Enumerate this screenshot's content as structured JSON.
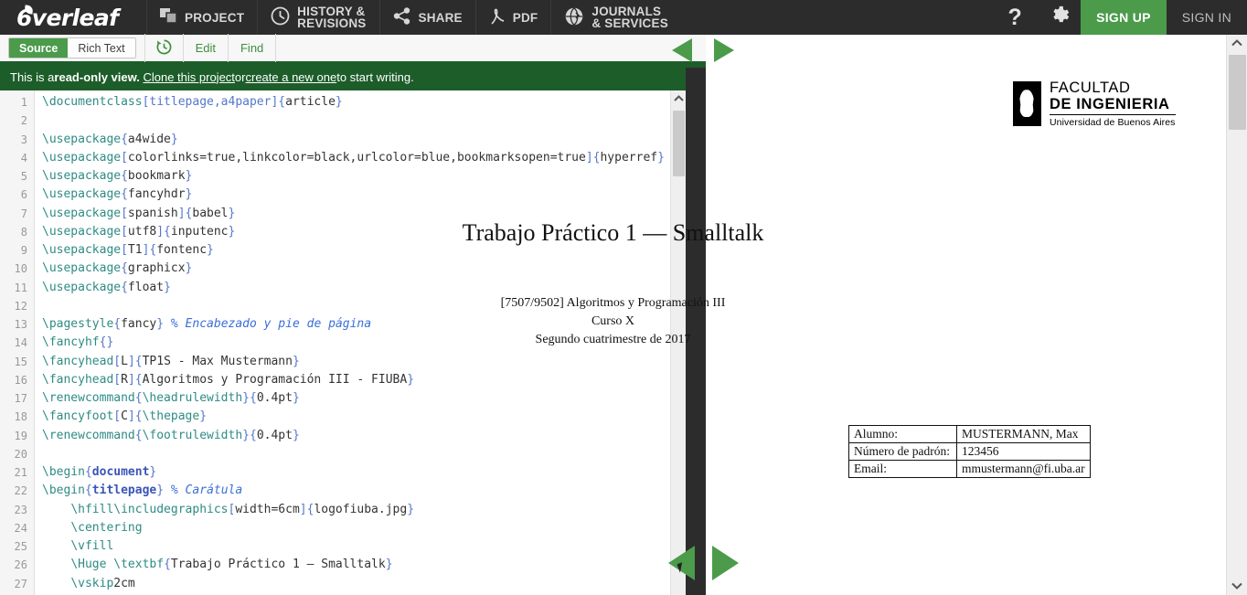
{
  "topnav": {
    "brand": "verleaf",
    "items": [
      {
        "name": "project",
        "label": "PROJECT",
        "icon": "windows-icon"
      },
      {
        "name": "history",
        "label": "HISTORY &",
        "label2": "REVISIONS",
        "icon": "clock-icon"
      },
      {
        "name": "share",
        "label": "SHARE",
        "icon": "share-icon"
      },
      {
        "name": "pdf",
        "label": "PDF",
        "icon": "pdf-icon"
      },
      {
        "name": "journals",
        "label": "JOURNALS",
        "label2": "& SERVICES",
        "icon": "globe-icon"
      }
    ],
    "help_icon": "question-mark-icon",
    "settings_icon": "gear-icon",
    "signup": "SIGN UP",
    "signin": "SIGN IN",
    "accent_green": "#4b9b4b",
    "bar_bg": "#2c2c2c"
  },
  "toolbar": {
    "source": "Source",
    "rich_text": "Rich Text",
    "history_icon": "history-clock-icon",
    "edit": "Edit",
    "find": "Find"
  },
  "banner": {
    "prefix": "This is a ",
    "bold": "read-only view.",
    "link1": "Clone this project",
    "mid": " or ",
    "link2": "create a new one",
    "suffix": " to start writing.",
    "bg": "#1d5d2a"
  },
  "editor": {
    "first_line": 1,
    "lines": [
      {
        "n": 1,
        "tokens": [
          {
            "t": "cmd",
            "v": "\\documentclass"
          },
          {
            "t": "br",
            "v": "[titlepage,a4paper]"
          },
          {
            "t": "br",
            "v": "{"
          },
          {
            "t": "txt",
            "v": "article"
          },
          {
            "t": "br",
            "v": "}"
          }
        ]
      },
      {
        "n": 2,
        "tokens": []
      },
      {
        "n": 3,
        "tokens": [
          {
            "t": "cmd",
            "v": "\\usepackage"
          },
          {
            "t": "br",
            "v": "{"
          },
          {
            "t": "txt",
            "v": "a4wide"
          },
          {
            "t": "br",
            "v": "}"
          }
        ]
      },
      {
        "n": 4,
        "tokens": [
          {
            "t": "cmd",
            "v": "\\usepackage"
          },
          {
            "t": "br",
            "v": "["
          },
          {
            "t": "txt",
            "v": "colorlinks=true,linkcolor=black,urlcolor=blue,bookmarksopen=true"
          },
          {
            "t": "br",
            "v": "]{"
          },
          {
            "t": "txt",
            "v": "hyperref"
          },
          {
            "t": "br",
            "v": "}"
          }
        ]
      },
      {
        "n": 5,
        "tokens": [
          {
            "t": "cmd",
            "v": "\\usepackage"
          },
          {
            "t": "br",
            "v": "{"
          },
          {
            "t": "txt",
            "v": "bookmark"
          },
          {
            "t": "br",
            "v": "}"
          }
        ]
      },
      {
        "n": 6,
        "tokens": [
          {
            "t": "cmd",
            "v": "\\usepackage"
          },
          {
            "t": "br",
            "v": "{"
          },
          {
            "t": "txt",
            "v": "fancyhdr"
          },
          {
            "t": "br",
            "v": "}"
          }
        ]
      },
      {
        "n": 7,
        "tokens": [
          {
            "t": "cmd",
            "v": "\\usepackage"
          },
          {
            "t": "br",
            "v": "["
          },
          {
            "t": "txt",
            "v": "spanish"
          },
          {
            "t": "br",
            "v": "]{"
          },
          {
            "t": "txt",
            "v": "babel"
          },
          {
            "t": "br",
            "v": "}"
          }
        ]
      },
      {
        "n": 8,
        "tokens": [
          {
            "t": "cmd",
            "v": "\\usepackage"
          },
          {
            "t": "br",
            "v": "["
          },
          {
            "t": "txt",
            "v": "utf8"
          },
          {
            "t": "br",
            "v": "]{"
          },
          {
            "t": "txt",
            "v": "inputenc"
          },
          {
            "t": "br",
            "v": "}"
          }
        ]
      },
      {
        "n": 9,
        "tokens": [
          {
            "t": "cmd",
            "v": "\\usepackage"
          },
          {
            "t": "br",
            "v": "["
          },
          {
            "t": "txt",
            "v": "T1"
          },
          {
            "t": "br",
            "v": "]{"
          },
          {
            "t": "txt",
            "v": "fontenc"
          },
          {
            "t": "br",
            "v": "}"
          }
        ]
      },
      {
        "n": 10,
        "tokens": [
          {
            "t": "cmd",
            "v": "\\usepackage"
          },
          {
            "t": "br",
            "v": "{"
          },
          {
            "t": "txt",
            "v": "graphicx"
          },
          {
            "t": "br",
            "v": "}"
          }
        ]
      },
      {
        "n": 11,
        "tokens": [
          {
            "t": "cmd",
            "v": "\\usepackage"
          },
          {
            "t": "br",
            "v": "{"
          },
          {
            "t": "txt",
            "v": "float"
          },
          {
            "t": "br",
            "v": "}"
          }
        ]
      },
      {
        "n": 12,
        "tokens": []
      },
      {
        "n": 13,
        "tokens": [
          {
            "t": "cmd",
            "v": "\\pagestyle"
          },
          {
            "t": "br",
            "v": "{"
          },
          {
            "t": "txt",
            "v": "fancy"
          },
          {
            "t": "br",
            "v": "}"
          },
          {
            "t": "txt",
            "v": " "
          },
          {
            "t": "com",
            "v": "% Encabezado y pie de página"
          }
        ]
      },
      {
        "n": 14,
        "tokens": [
          {
            "t": "cmd",
            "v": "\\fancyhf"
          },
          {
            "t": "br",
            "v": "{}"
          }
        ]
      },
      {
        "n": 15,
        "tokens": [
          {
            "t": "cmd",
            "v": "\\fancyhead"
          },
          {
            "t": "br",
            "v": "["
          },
          {
            "t": "txt",
            "v": "L"
          },
          {
            "t": "br",
            "v": "]{"
          },
          {
            "t": "txt",
            "v": "TP1S - Max Mustermann"
          },
          {
            "t": "br",
            "v": "}"
          }
        ]
      },
      {
        "n": 16,
        "tokens": [
          {
            "t": "cmd",
            "v": "\\fancyhead"
          },
          {
            "t": "br",
            "v": "["
          },
          {
            "t": "txt",
            "v": "R"
          },
          {
            "t": "br",
            "v": "]{"
          },
          {
            "t": "txt",
            "v": "Algoritmos y Programación III - FIUBA"
          },
          {
            "t": "br",
            "v": "}"
          }
        ]
      },
      {
        "n": 17,
        "tokens": [
          {
            "t": "cmd",
            "v": "\\renewcommand"
          },
          {
            "t": "br",
            "v": "{"
          },
          {
            "t": "cmd",
            "v": "\\headrulewidth"
          },
          {
            "t": "br",
            "v": "}{"
          },
          {
            "t": "txt",
            "v": "0.4pt"
          },
          {
            "t": "br",
            "v": "}"
          }
        ]
      },
      {
        "n": 18,
        "tokens": [
          {
            "t": "cmd",
            "v": "\\fancyfoot"
          },
          {
            "t": "br",
            "v": "["
          },
          {
            "t": "txt",
            "v": "C"
          },
          {
            "t": "br",
            "v": "]{"
          },
          {
            "t": "cmd",
            "v": "\\thepage"
          },
          {
            "t": "br",
            "v": "}"
          }
        ]
      },
      {
        "n": 19,
        "tokens": [
          {
            "t": "cmd",
            "v": "\\renewcommand"
          },
          {
            "t": "br",
            "v": "{"
          },
          {
            "t": "cmd",
            "v": "\\footrulewidth"
          },
          {
            "t": "br",
            "v": "}{"
          },
          {
            "t": "txt",
            "v": "0.4pt"
          },
          {
            "t": "br",
            "v": "}"
          }
        ]
      },
      {
        "n": 20,
        "tokens": []
      },
      {
        "n": 21,
        "tokens": [
          {
            "t": "cmd",
            "v": "\\begin"
          },
          {
            "t": "br",
            "v": "{"
          },
          {
            "t": "env",
            "v": "document"
          },
          {
            "t": "br",
            "v": "}"
          }
        ]
      },
      {
        "n": 22,
        "tokens": [
          {
            "t": "cmd",
            "v": "\\begin"
          },
          {
            "t": "br",
            "v": "{"
          },
          {
            "t": "env",
            "v": "titlepage"
          },
          {
            "t": "br",
            "v": "}"
          },
          {
            "t": "txt",
            "v": " "
          },
          {
            "t": "com",
            "v": "% Carátula"
          }
        ]
      },
      {
        "n": 23,
        "tokens": [
          {
            "t": "txt",
            "v": "    "
          },
          {
            "t": "cmd",
            "v": "\\hfill\\includegraphics"
          },
          {
            "t": "br",
            "v": "["
          },
          {
            "t": "txt",
            "v": "width=6cm"
          },
          {
            "t": "br",
            "v": "]{"
          },
          {
            "t": "txt",
            "v": "logofiuba.jpg"
          },
          {
            "t": "br",
            "v": "}"
          }
        ]
      },
      {
        "n": 24,
        "tokens": [
          {
            "t": "txt",
            "v": "    "
          },
          {
            "t": "cmd",
            "v": "\\centering"
          }
        ]
      },
      {
        "n": 25,
        "tokens": [
          {
            "t": "txt",
            "v": "    "
          },
          {
            "t": "cmd",
            "v": "\\vfill"
          }
        ]
      },
      {
        "n": 26,
        "tokens": [
          {
            "t": "txt",
            "v": "    "
          },
          {
            "t": "cmd",
            "v": "\\Huge \\textbf"
          },
          {
            "t": "br",
            "v": "{"
          },
          {
            "t": "txt",
            "v": "Trabajo Práctico 1 — Smalltalk"
          },
          {
            "t": "br",
            "v": "}"
          }
        ]
      },
      {
        "n": 27,
        "tokens": [
          {
            "t": "txt",
            "v": "    "
          },
          {
            "t": "cmd",
            "v": "\\vskip"
          },
          {
            "t": "txt",
            "v": "2cm"
          }
        ]
      }
    ]
  },
  "pdf": {
    "logo": {
      "line1": "FACULTAD",
      "line2": "DE INGENIERIA",
      "line3": "Universidad de Buenos Aires"
    },
    "title": "Trabajo Práctico 1 — Smalltalk",
    "subtitle_lines": [
      "[7507/9502] Algoritmos y Programación III",
      "Curso X",
      "Segundo cuatrimestre de 2017"
    ],
    "table": [
      {
        "key": "Alumno:",
        "value": "MUSTERMANN, Max"
      },
      {
        "key": "Número de padrón:",
        "value": "123456"
      },
      {
        "key": "Email:",
        "value": "mmustermann@fi.uba.ar"
      }
    ]
  },
  "splitter": {
    "collapse_left_icon": "arrow-left-icon",
    "expand_right_icon": "arrow-right-icon"
  },
  "scrollbars": {
    "up_icon": "chevron-up-icon",
    "down_icon": "chevron-down-icon"
  }
}
